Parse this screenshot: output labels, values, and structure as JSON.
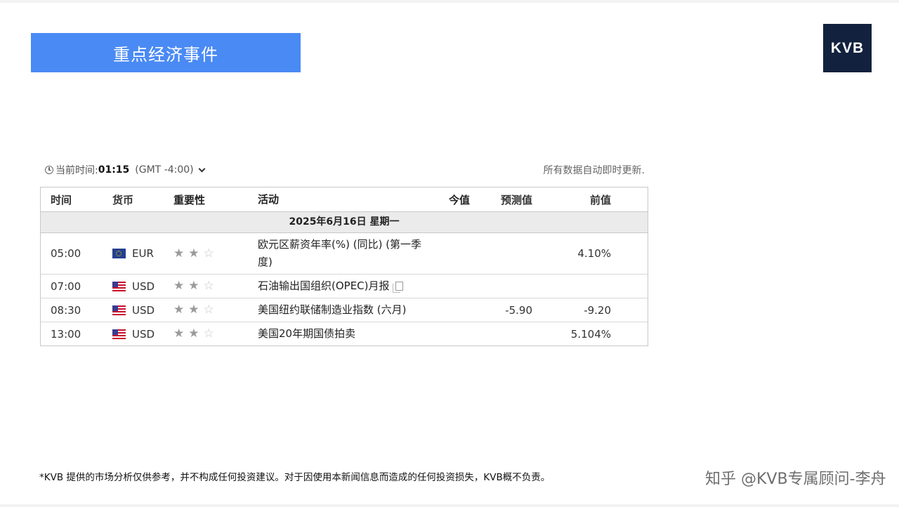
{
  "slide": {
    "title": "重点经济事件",
    "logo_text": "KVB",
    "disclaimer": "*KVB 提供的市场分析仅供参考，并不构成任何投资建议。对于因使用本新闻信息而造成的任何投资损失，KVB概不负责。",
    "watermark": "知乎 @KVB专属顾问-李舟"
  },
  "calendar": {
    "current_time_label": "当前时间:",
    "current_time": "01:15",
    "timezone": "(GMT -4:00)",
    "auto_update": "所有数据自动即时更新.",
    "columns": {
      "time": "时间",
      "currency": "货币",
      "importance": "重要性",
      "event": "活动",
      "actual": "今值",
      "forecast": "预测值",
      "previous": "前值"
    },
    "date_row": "2025年6月16日  星期一",
    "rows": [
      {
        "time": "05:00",
        "flag": "eu-flag",
        "currency": "EUR",
        "stars": 2,
        "event": "欧元区薪资年率(%) (同比) (第一季度)",
        "actual": "",
        "forecast": "",
        "previous": "4.10%"
      },
      {
        "time": "07:00",
        "flag": "us-flag",
        "currency": "USD",
        "stars": 2,
        "event": "石油输出国组织(OPEC)月报",
        "actual": "",
        "forecast": "",
        "previous": ""
      },
      {
        "time": "08:30",
        "flag": "us-flag",
        "currency": "USD",
        "stars": 2,
        "event": "美国纽约联储制造业指数 (六月)",
        "actual": "",
        "forecast": "-5.90",
        "previous": "-9.20"
      },
      {
        "time": "13:00",
        "flag": "us-flag",
        "currency": "USD",
        "stars": 2,
        "event": "美国20年期国债拍卖",
        "actual": "",
        "forecast": "",
        "previous": "5.104%"
      }
    ]
  }
}
